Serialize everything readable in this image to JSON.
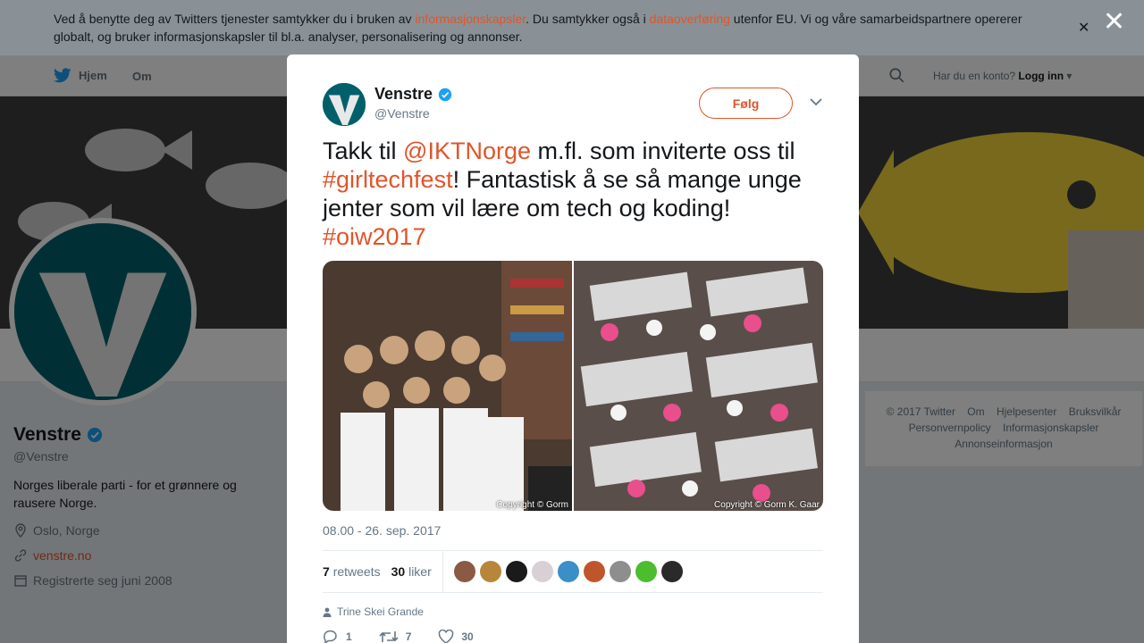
{
  "nav": {
    "home_label": "Hjem",
    "about_label": "Om",
    "account_question": "Har du en konto?",
    "login_label": "Logg inn"
  },
  "profile": {
    "name": "Venstre",
    "handle": "@Venstre",
    "bio": "Norges liberale parti - for et grønnere og rausere Norge.",
    "location": "Oslo, Norge",
    "website": "venstre.no",
    "joined": "Registrerte seg juni 2008"
  },
  "footer": {
    "copyright": "© 2017 Twitter",
    "links": [
      "Om",
      "Hjelpesenter",
      "Bruksvilkår",
      "Personvernpolicy",
      "Informasjonskapsler",
      "Annonseinformasjon"
    ]
  },
  "cookie": {
    "text_1": "Ved å benytte deg av Twitters tjenester samtykker du i bruken av ",
    "link_1": "informasjonskapsler",
    "text_2": ". Du samtykker også i ",
    "link_2": "dataoverføring",
    "text_3": " utenfor EU. Vi og våre samarbeidspartnere opererer globalt, og bruker informasjonskapsler til bl.a. analyser, personalisering og annonser.",
    "close_glyph": "✕"
  },
  "modal": {
    "close_glyph": "✕"
  },
  "tweet": {
    "name": "Venstre",
    "handle": "@Venstre",
    "follow_label": "Følg",
    "text_1": "Takk til ",
    "mention": "@IKTNorge",
    "text_2": " m.fl. som inviterte oss til ",
    "hashtag_1": "#girltechfest",
    "text_3": "! Fantastisk å se så mange unge jenter som vil lære om tech og koding! ",
    "hashtag_2": "#oiw2017",
    "photo_1_copyright": "Copyright © Gorm",
    "photo_2_copyright": "Copyright © Gorm K. Gaar",
    "timestamp": "08.00 - 26. sep. 2017",
    "retweets_count": "7",
    "retweets_label": "retweets",
    "likes_count": "30",
    "likes_label": "liker",
    "context_user": "Trine Skei Grande",
    "replies": "1",
    "retweets_action": "7",
    "likes_action": "30"
  },
  "colors": {
    "accent": "#e0552a",
    "brand_avatar": "#00606a",
    "verified": "#1da1f2"
  }
}
